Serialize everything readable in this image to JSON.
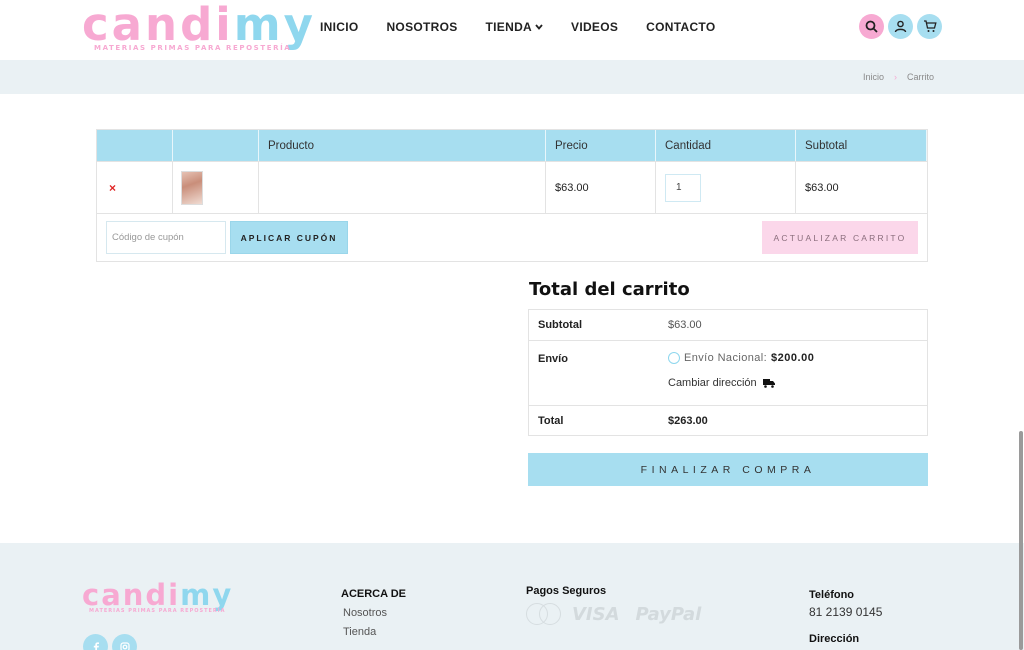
{
  "brand": {
    "logo_part1": "candi",
    "logo_part2": "my",
    "tagline": "MATERIAS PRIMAS PARA REPOSTERÍA",
    "colors": {
      "pink": "#f7a9d2",
      "blue": "#a7def0",
      "bar": "#eaf1f4",
      "remove": "#e02424"
    }
  },
  "nav": {
    "items": [
      {
        "label": "INICIO"
      },
      {
        "label": "NOSOTROS"
      },
      {
        "label": "TIENDA"
      },
      {
        "label": "VIDEOS"
      },
      {
        "label": "CONTACTO"
      }
    ],
    "icons": [
      "search-icon",
      "user-icon",
      "cart-icon"
    ]
  },
  "breadcrumb": {
    "home": "Inicio",
    "separator": "›",
    "current": "Carrito"
  },
  "cart": {
    "headers": [
      "",
      "",
      "Producto",
      "Precio",
      "Cantidad",
      "Subtotal"
    ],
    "rows": [
      {
        "remove": "×",
        "product": "",
        "price": "$63.00",
        "quantity": "1",
        "subtotal": "$63.00"
      }
    ],
    "coupon_placeholder": "Código de cupón",
    "apply_coupon": "APLICAR CUPÓN",
    "update_cart": "ACTUALIZAR CARRITO"
  },
  "totals": {
    "title": "Total del carrito",
    "subtotal_label": "Subtotal",
    "subtotal_value": "$63.00",
    "shipping_label": "Envío",
    "shipping_option": "Envío Nacional:",
    "shipping_price": "$200.00",
    "change_address": "Cambiar dirección",
    "total_label": "Total",
    "total_value": "$263.00",
    "checkout": "FINALIZAR COMPRA"
  },
  "footer": {
    "about_heading": "ACERCA DE",
    "about_links": [
      "Nosotros",
      "Tienda"
    ],
    "pay_heading": "Pagos Seguros",
    "pay_visa": "VISA",
    "pay_paypal": "PayPal",
    "phone_heading": "Teléfono",
    "phone_value": "81 2139 0145",
    "address_heading": "Dirección",
    "socials": [
      "facebook-icon",
      "instagram-icon"
    ]
  }
}
